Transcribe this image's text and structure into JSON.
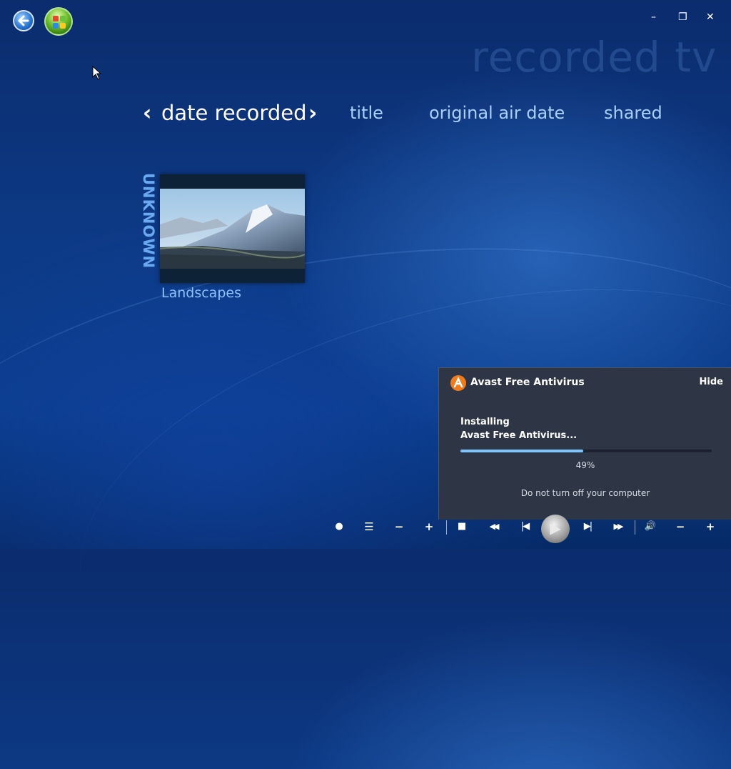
{
  "app": {
    "section_watermark": "recorded tv"
  },
  "window_controls": {
    "minimize": "–",
    "restore": "❐",
    "close": "✕"
  },
  "tabs": {
    "prev_chevron": "‹",
    "next_chevron": "›",
    "items": [
      {
        "label": "date recorded",
        "active": true
      },
      {
        "label": "title",
        "active": false
      },
      {
        "label": "original air date",
        "active": false
      },
      {
        "label": "shared",
        "active": false
      }
    ]
  },
  "library": {
    "group_label": "UNKNOWN",
    "items": [
      {
        "caption": "Landscapes"
      }
    ]
  },
  "notification": {
    "title": "Avast Free Antivirus",
    "hide_label": "Hide",
    "status_line1": "Installing",
    "status_line2": "Avast Free Antivirus...",
    "progress_percent": 49,
    "progress_label": "49%",
    "warning": "Do not turn off your computer",
    "accent_color": "#f07b1b"
  },
  "transport": {
    "record": "●",
    "guide": "☰",
    "channel_down": "−",
    "channel_up": "+",
    "stop": "■",
    "rewind": "◀◀",
    "previous": "|◀",
    "play": "▶",
    "next": "▶|",
    "fast_forward": "▶▶",
    "mute": "🔊",
    "volume_down": "−",
    "volume_up": "+"
  }
}
